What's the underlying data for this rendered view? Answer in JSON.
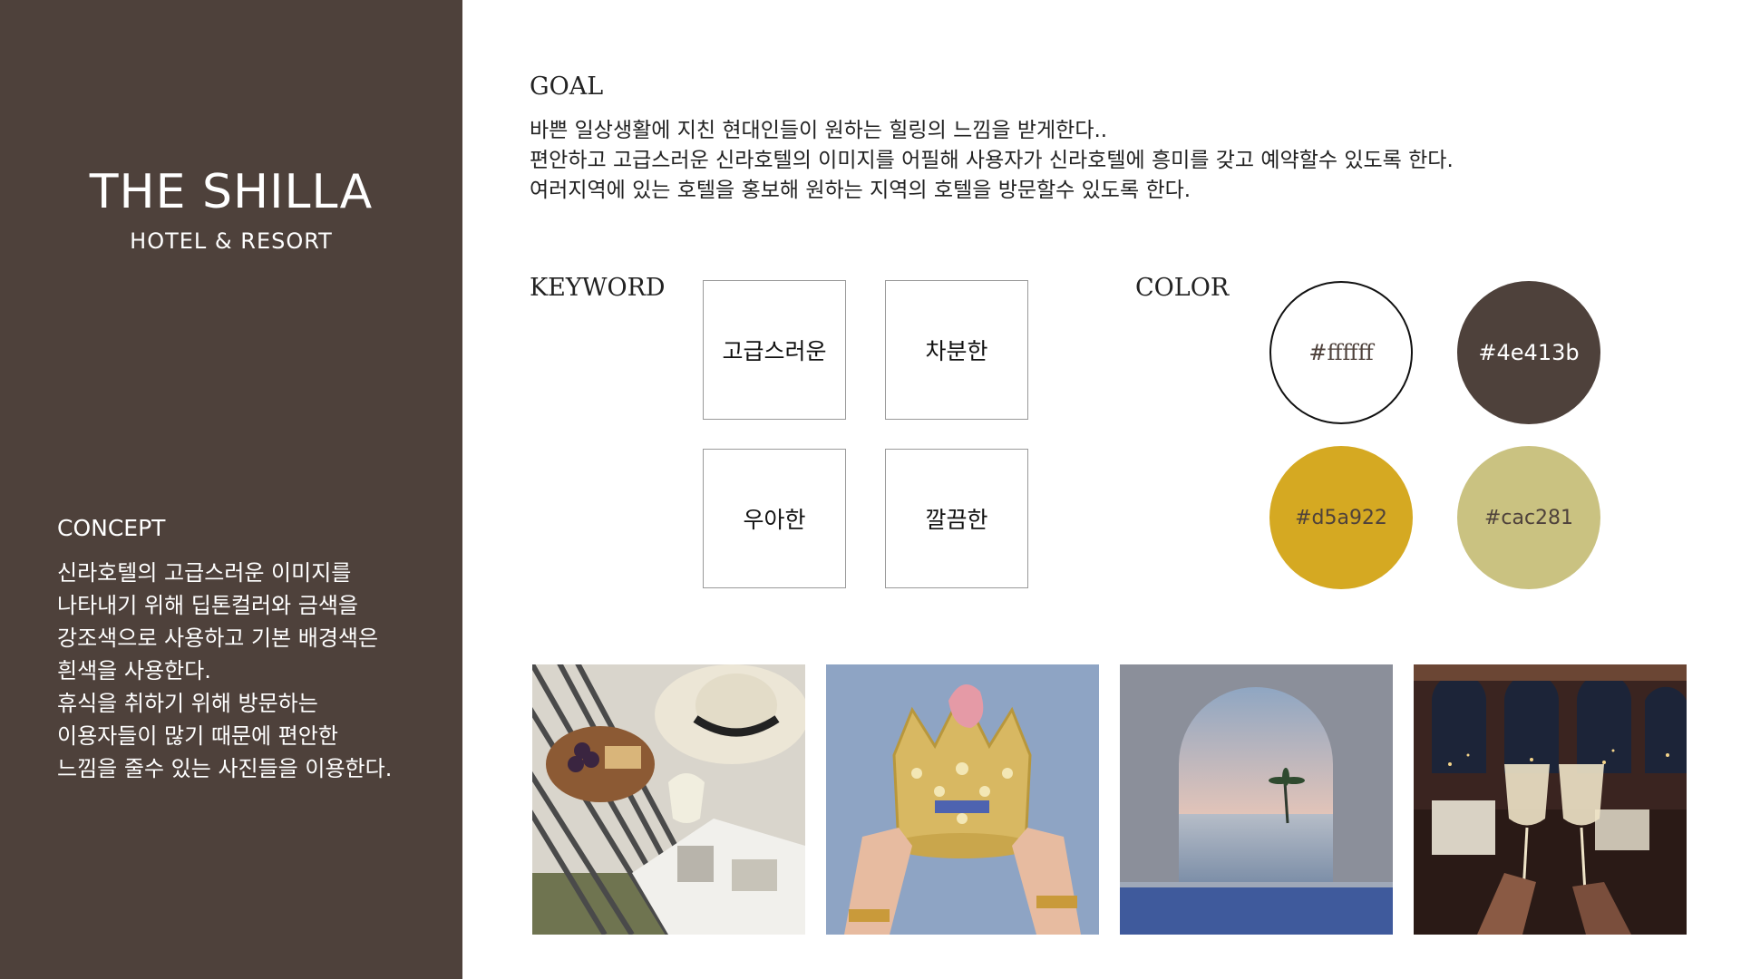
{
  "brand": {
    "title": "THE SHILLA",
    "subtitle": "HOTEL & RESORT"
  },
  "concept": {
    "title": "CONCEPT",
    "lines": [
      "신라호텔의 고급스러운 이미지를",
      "나타내기 위해 딥톤컬러와 금색을",
      "강조색으로 사용하고 기본 배경색은",
      "흰색을 사용한다.",
      "휴식을 취하기 위해 방문하는",
      "이용자들이 많기 때문에 편안한",
      "느낌을 줄수 있는 사진들을 이용한다."
    ]
  },
  "goal": {
    "title": "GOAL",
    "lines": [
      "바쁜 일상생활에 지친 현대인들이 원하는 힐링의 느낌을 받게한다..",
      "편안하고 고급스러운 신라호텔의 이미지를 어필해 사용자가 신라호텔에 흥미를 갖고 예약할수 있도록 한다.",
      "여러지역에 있는 호텔을 홍보해 원하는 지역의 호텔을 방문할수 있도록 한다."
    ]
  },
  "keyword": {
    "title": "KEYWORD",
    "items": [
      "고급스러운",
      "차분한",
      "우아한",
      "깔끔한"
    ]
  },
  "color": {
    "title": "COLOR",
    "swatches": [
      {
        "label": "#ffffff",
        "hex": "#ffffff"
      },
      {
        "label": "#4e413b",
        "hex": "#4e413b"
      },
      {
        "label": "#d5a922",
        "hex": "#d5a922"
      },
      {
        "label": "#cac281",
        "hex": "#cac281"
      }
    ]
  },
  "photos": [
    {
      "name": "picnic-photo"
    },
    {
      "name": "crown-photo"
    },
    {
      "name": "arch-sea-photo"
    },
    {
      "name": "wine-toast-photo"
    }
  ]
}
